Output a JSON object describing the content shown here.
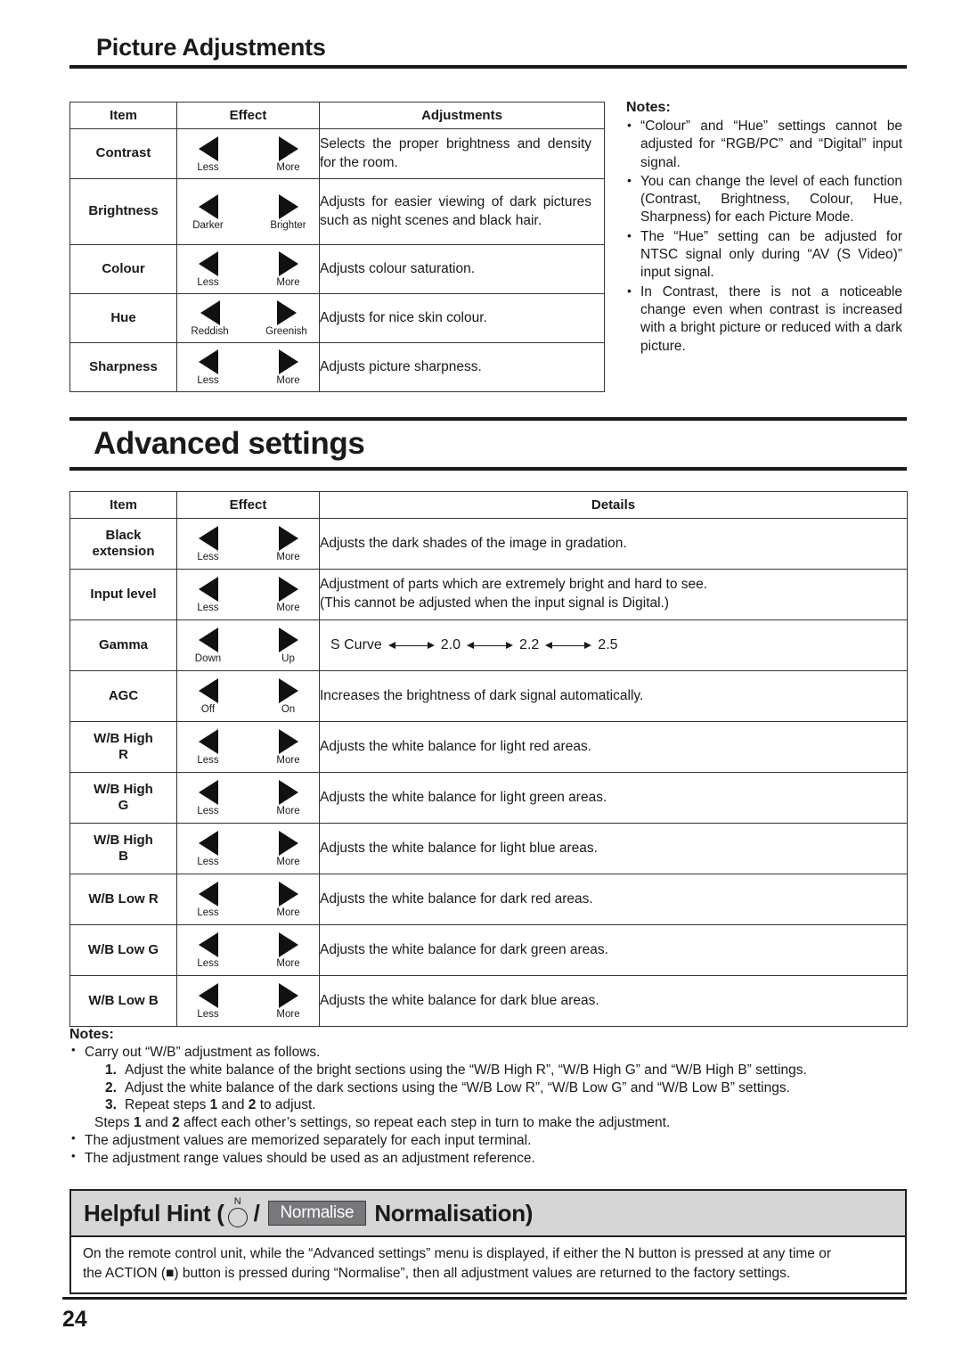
{
  "page": {
    "number": "24"
  },
  "picture_section": {
    "heading": "Picture Adjustments",
    "table": {
      "headers": [
        "Item",
        "Effect",
        "Adjustments"
      ],
      "rows": [
        {
          "item": "Contrast",
          "left_label": "Less",
          "right_label": "More",
          "detail": "Selects the proper brightness and density for the room."
        },
        {
          "item": "Brightness",
          "left_label": "Darker",
          "right_label": "Brighter",
          "detail": "Adjusts for easier viewing of dark pictures such as night scenes and black hair."
        },
        {
          "item": "Colour",
          "left_label": "Less",
          "right_label": "More",
          "detail": "Adjusts colour saturation."
        },
        {
          "item": "Hue",
          "left_label": "Reddish",
          "right_label": "Greenish",
          "detail": "Adjusts for nice skin colour."
        },
        {
          "item": "Sharpness",
          "left_label": "Less",
          "right_label": "More",
          "detail": "Adjusts picture sharpness."
        }
      ]
    },
    "notes": {
      "title": "Notes:",
      "items": [
        "“Colour” and “Hue” settings cannot be adjusted for “RGB/PC” and “Digital” input signal.",
        "You can change the level of each function (Contrast, Brightness, Colour, Hue, Sharpness) for each Picture Mode.",
        "The “Hue” setting can be adjusted for NTSC signal only during “AV (S Video)” input signal.",
        "In Contrast, there is not a noticeable change even when contrast is increased with a bright picture or reduced with a dark picture."
      ]
    }
  },
  "advanced_section": {
    "heading": "Advanced settings",
    "table": {
      "headers": [
        "Item",
        "Effect",
        "Details"
      ],
      "rows": [
        {
          "item": "Black extension",
          "item_line1": "Black",
          "item_line2": "extension",
          "left_label": "Less",
          "right_label": "More",
          "detail": "Adjusts the dark shades of the image in gradation."
        },
        {
          "item": "Input level",
          "item_line1": "Input level",
          "item_line2": "",
          "left_label": "Less",
          "right_label": "More",
          "detail": "Adjustment of parts which are extremely bright and hard to see.",
          "detail2": "(This cannot be adjusted when the input signal is Digital.)"
        },
        {
          "item": "Gamma",
          "item_line1": "Gamma",
          "item_line2": "",
          "left_label": "Down",
          "right_label": "Up",
          "gamma_steps": [
            "S Curve",
            "2.0",
            "2.2",
            "2.5"
          ]
        },
        {
          "item": "AGC",
          "item_line1": "AGC",
          "item_line2": "",
          "left_label": "Off",
          "right_label": "On",
          "detail": "Increases the brightness of dark signal automatically."
        },
        {
          "item": "W/B High R",
          "item_line1": "W/B High",
          "item_line2": "R",
          "left_label": "Less",
          "right_label": "More",
          "detail": "Adjusts the white balance for light red areas."
        },
        {
          "item": "W/B High G",
          "item_line1": "W/B High",
          "item_line2": "G",
          "left_label": "Less",
          "right_label": "More",
          "detail": "Adjusts the white balance for light green areas."
        },
        {
          "item": "W/B High B",
          "item_line1": "W/B High",
          "item_line2": "B",
          "left_label": "Less",
          "right_label": "More",
          "detail": "Adjusts the white balance for light blue areas."
        },
        {
          "item": "W/B Low R",
          "item_line1": "W/B Low R",
          "item_line2": "",
          "left_label": "Less",
          "right_label": "More",
          "detail": "Adjusts the white balance for dark red areas."
        },
        {
          "item": "W/B Low G",
          "item_line1": "W/B Low G",
          "item_line2": "",
          "left_label": "Less",
          "right_label": "More",
          "detail": "Adjusts the white balance for dark green areas."
        },
        {
          "item": "W/B Low B",
          "item_line1": "W/B Low B",
          "item_line2": "",
          "left_label": "Less",
          "right_label": "More",
          "detail": "Adjusts the white balance for dark blue areas."
        }
      ]
    },
    "notes": {
      "title": "Notes:",
      "bullet1": "Carry out “W/B” adjustment as follows.",
      "step1_num": "1.",
      "step1": "Adjust the white balance of the bright sections using the “W/B High R”, “W/B High G” and “W/B High B” settings.",
      "step2_num": "2.",
      "step2": "Adjust the white balance of the dark sections using the “W/B Low R”, “W/B Low G” and “W/B Low B” settings.",
      "step3_num": "3.",
      "step3_a": "Repeat steps ",
      "step3_b": "1",
      "step3_c": " and ",
      "step3_d": "2",
      "step3_e": " to adjust.",
      "steps_note_a": "Steps ",
      "steps_note_b": "1",
      "steps_note_c": " and ",
      "steps_note_d": "2",
      "steps_note_e": " affect each other’s settings, so repeat each step in turn to make the adjustment.",
      "bullet2": "The adjustment values are memorized separately for each input terminal.",
      "bullet3": "The adjustment range values should be used as an adjustment reference."
    }
  },
  "helpful_hint": {
    "title_prefix": "Helpful Hint (",
    "n_label": "N",
    "slash": "/",
    "normalise_badge": "Normalise",
    "title_suffix": "Normalisation)",
    "body_line1": "On the remote control unit, while the “Advanced settings” menu is displayed, if either the N button is pressed at any time or",
    "body_line2_a": "the ACTION (",
    "body_line2_icon": "■",
    "body_line2_b": ") button is pressed during “Normalise”, then all adjustment values are returned to the factory settings."
  },
  "colors": {
    "ink": "#1a1a1a",
    "rule": "#231f20",
    "hint_header_bg": "#d6d6d6",
    "badge_bg": "#77787b",
    "badge_text": "#ffffff"
  }
}
